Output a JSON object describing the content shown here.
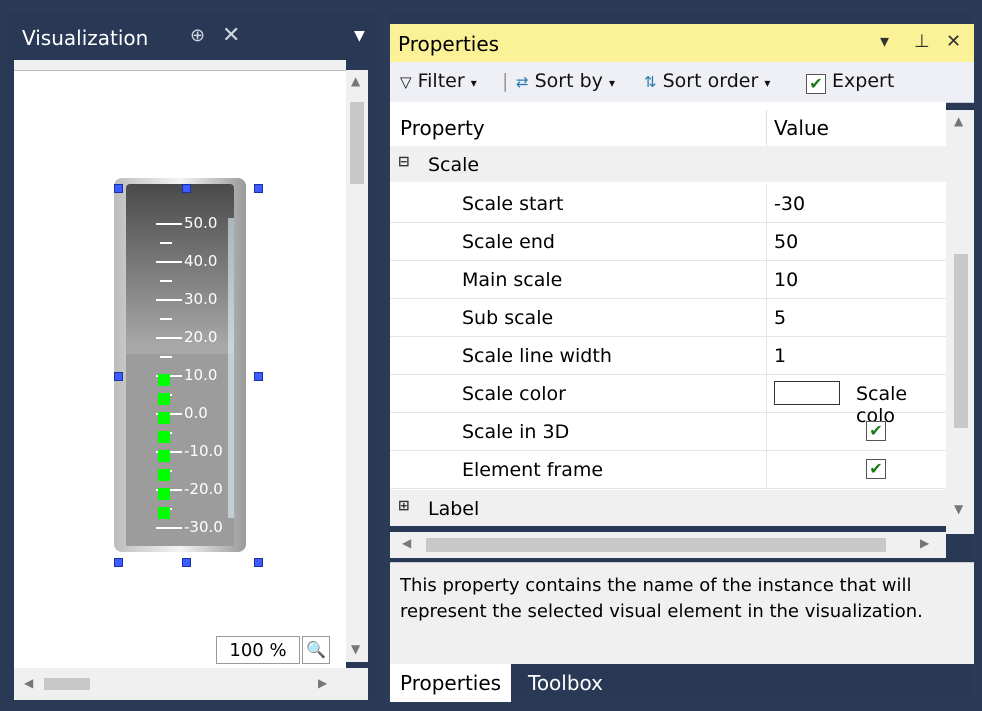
{
  "visualization": {
    "title": "Visualization",
    "zoom": "100 %",
    "scale_labels": [
      "50.0",
      "40.0",
      "30.0",
      "20.0",
      "10.0",
      "0.0",
      "-10.0",
      "-20.0",
      "-30.0"
    ]
  },
  "properties": {
    "title": "Properties",
    "toolbar": {
      "filter": "Filter",
      "sort_by": "Sort by",
      "sort_order": "Sort order",
      "expert": "Expert"
    },
    "columns": {
      "property": "Property",
      "value": "Value"
    },
    "category_scale": "Scale",
    "category_label": "Label",
    "rows": [
      {
        "name": "Scale start",
        "value": "-30"
      },
      {
        "name": "Scale end",
        "value": "50"
      },
      {
        "name": "Main scale",
        "value": "10"
      },
      {
        "name": "Sub scale",
        "value": "5"
      },
      {
        "name": "Scale line width",
        "value": "1"
      },
      {
        "name": "Scale color",
        "value": "Scale colo"
      },
      {
        "name": "Scale in 3D",
        "value": ""
      },
      {
        "name": "Element frame",
        "value": ""
      }
    ],
    "description": "This property contains the name of the instance that will represent the selected visual element in the visualization.",
    "tabs": [
      "Properties",
      "Toolbox"
    ]
  },
  "colors": {
    "frame": "#293955",
    "title_active": "#fbf197",
    "bar_green": "#00ff00",
    "handle_blue": "#3c5cff"
  }
}
